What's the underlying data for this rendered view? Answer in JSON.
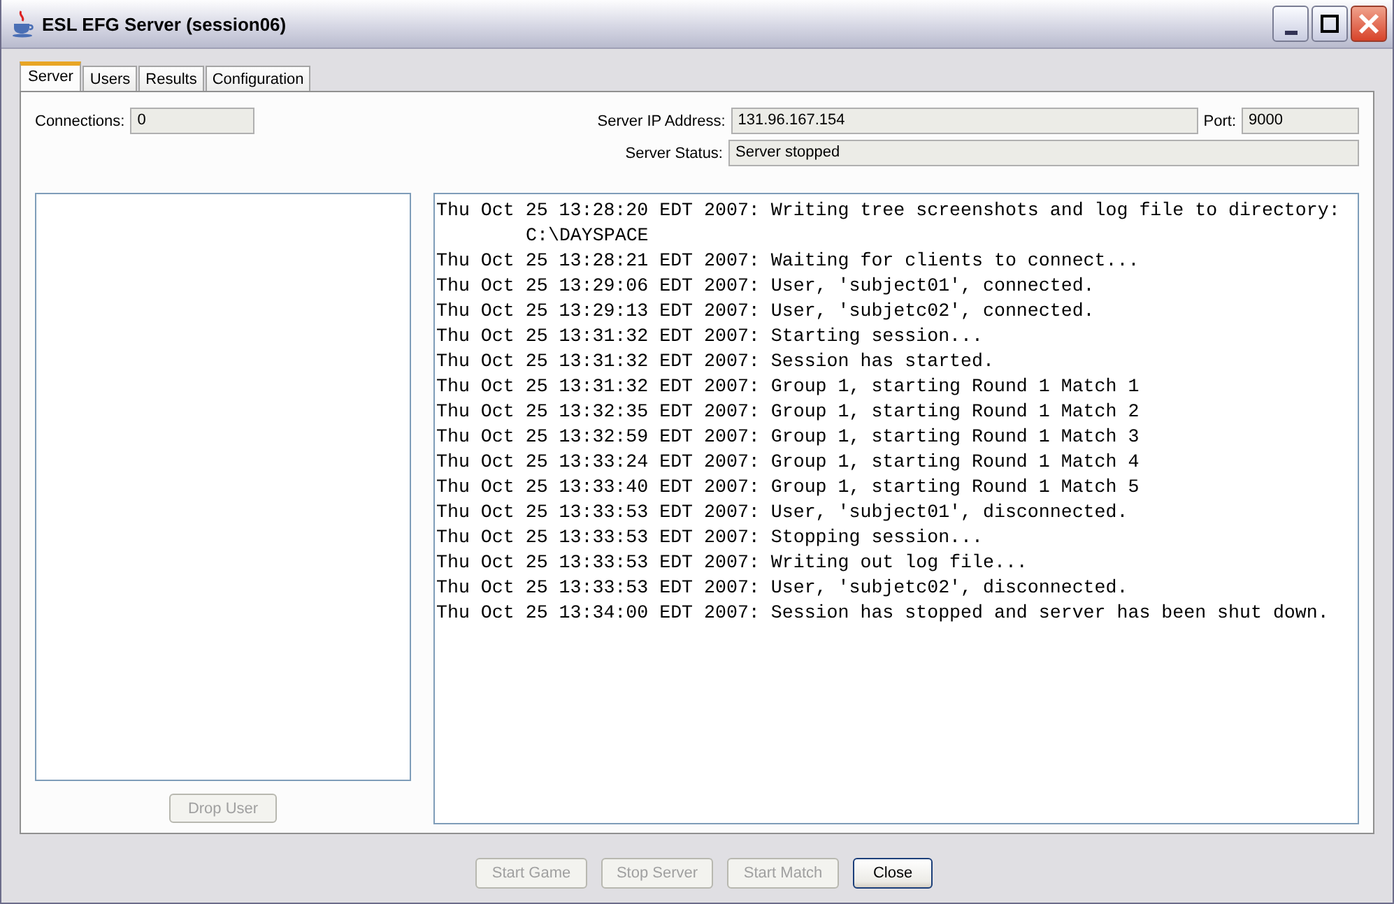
{
  "window": {
    "title": "ESL EFG Server (session06)"
  },
  "tabs": [
    {
      "label": "Server",
      "selected": true
    },
    {
      "label": "Users",
      "selected": false
    },
    {
      "label": "Results",
      "selected": false
    },
    {
      "label": "Configuration",
      "selected": false
    }
  ],
  "connections": {
    "label": "Connections:",
    "value": "0"
  },
  "server_ip": {
    "label": "Server IP Address:",
    "value": "131.96.167.154"
  },
  "port": {
    "label": "Port:",
    "value": "9000"
  },
  "server_status": {
    "label": "Server Status:",
    "value": "Server stopped"
  },
  "drop_user_button": {
    "label": "Drop User",
    "disabled": true
  },
  "log": [
    "Thu Oct 25 13:28:20 EDT 2007: Writing tree screenshots and log file to directory: C:\\DAYSPACE",
    "Thu Oct 25 13:28:21 EDT 2007: Waiting for clients to connect...",
    "Thu Oct 25 13:29:06 EDT 2007: User, 'subject01', connected.",
    "Thu Oct 25 13:29:13 EDT 2007: User, 'subjetc02', connected.",
    "Thu Oct 25 13:31:32 EDT 2007: Starting session...",
    "Thu Oct 25 13:31:32 EDT 2007: Session has started.",
    "Thu Oct 25 13:31:32 EDT 2007: Group 1, starting Round 1 Match 1",
    "Thu Oct 25 13:32:35 EDT 2007: Group 1, starting Round 1 Match 2",
    "Thu Oct 25 13:32:59 EDT 2007: Group 1, starting Round 1 Match 3",
    "Thu Oct 25 13:33:24 EDT 2007: Group 1, starting Round 1 Match 4",
    "Thu Oct 25 13:33:40 EDT 2007: Group 1, starting Round 1 Match 5",
    "Thu Oct 25 13:33:53 EDT 2007: User, 'subject01', disconnected.",
    "Thu Oct 25 13:33:53 EDT 2007: Stopping session...",
    "Thu Oct 25 13:33:53 EDT 2007: Writing out log file...",
    "Thu Oct 25 13:33:53 EDT 2007: User, 'subjetc02', disconnected.",
    "Thu Oct 25 13:34:00 EDT 2007: Session has stopped and server has been shut down."
  ],
  "buttons": [
    {
      "label": "Start Game",
      "disabled": true
    },
    {
      "label": "Stop Server",
      "disabled": true
    },
    {
      "label": "Start Match",
      "disabled": true
    },
    {
      "label": "Close",
      "disabled": false
    }
  ]
}
